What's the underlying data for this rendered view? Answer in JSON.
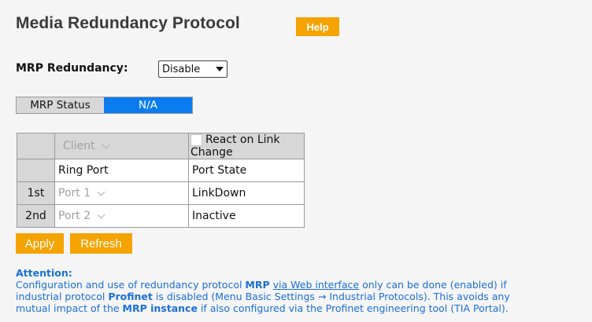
{
  "page": {
    "title": "Media Redundancy Protocol",
    "help_label": "Help"
  },
  "mrp_redundancy": {
    "label": "MRP Redundancy:",
    "selected": "Disable"
  },
  "mrp_status": {
    "label": "MRP Status",
    "value": "N/A"
  },
  "table": {
    "role_selected": "Client",
    "react_label": "React on Link Change",
    "react_checked": false,
    "header_ring_port": "Ring Port",
    "header_port_state": "Port State",
    "rows": [
      {
        "label": "1st",
        "port": "Port 1",
        "state": "LinkDown"
      },
      {
        "label": "2nd",
        "port": "Port 2",
        "state": "Inactive"
      }
    ]
  },
  "buttons": {
    "apply": "Apply",
    "refresh": "Refresh"
  },
  "attention": {
    "title": "Attention:",
    "line1_a": "Configuration and use of redundancy protocol ",
    "line1_mrp": "MRP",
    "line1_b": " ",
    "line1_link": "via Web interface",
    "line1_c": " only can be done (enabled) if",
    "line2_a": "industrial protocol ",
    "line2_profinet": "Profinet",
    "line2_b": " is disabled (Menu Basic Settings → Industrial Protocols). This avoids any",
    "line3_a": "mutual impact of the ",
    "line3_instance": "MRP instance",
    "line3_b": " if also configured via the Profinet engineering tool (TIA Portal)."
  },
  "colors": {
    "accent_orange": "#f5a300",
    "status_blue": "#0a7cf0",
    "attention_blue": "#1a6fd8"
  }
}
